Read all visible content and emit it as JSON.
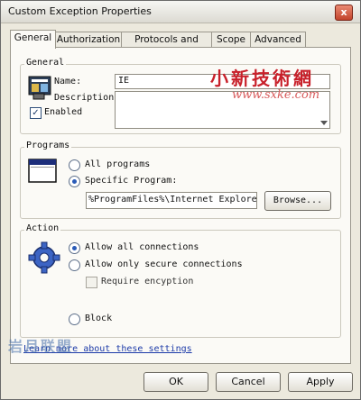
{
  "window": {
    "title": "Custom Exception Properties",
    "close_symbol": "x"
  },
  "tabs": [
    {
      "label": "General",
      "active": true
    },
    {
      "label": "Authorization",
      "active": false
    },
    {
      "label": "Protocols and Ports",
      "active": false
    },
    {
      "label": "Scope",
      "active": false
    },
    {
      "label": "Advanced",
      "active": false
    }
  ],
  "general_group": {
    "label": "General",
    "name_label": "Name:",
    "name_value": "IE",
    "description_label": "Description:",
    "description_value": "",
    "enabled_label": "Enabled",
    "enabled_checked": true
  },
  "programs_group": {
    "label": "Programs",
    "all_programs_label": "All programs",
    "specific_program_label": "Specific Program:",
    "selected": "specific",
    "program_path": "%ProgramFiles%\\Internet Explore",
    "browse_label": "Browse..."
  },
  "action_group": {
    "label": "Action",
    "allow_all_label": "Allow all connections",
    "allow_secure_label": "Allow only secure connections",
    "require_encryption_label": "Require encyption",
    "block_label": "Block",
    "selected": "allow_all"
  },
  "learn_more_link": "Learn more about these settings",
  "buttons": {
    "ok": "OK",
    "cancel": "Cancel",
    "apply": "Apply"
  },
  "watermarks": {
    "top_cn": "小新技術網",
    "top_url": "www.sxke.com",
    "bottom_cn": "岩月联盟"
  },
  "colors": {
    "accent_blue": "#2a5bb8",
    "watermark_red": "#c8202a",
    "link_blue": "#1c3aa8"
  }
}
